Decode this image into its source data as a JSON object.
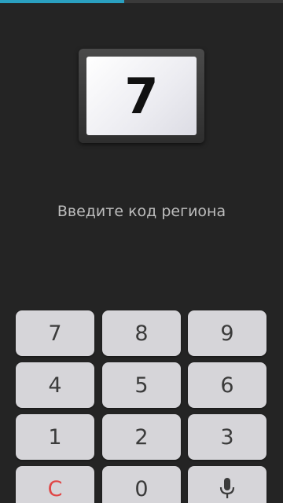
{
  "progress": {
    "fraction": 0.44
  },
  "plate": {
    "value": "7"
  },
  "prompt": {
    "text": "Введите код региона"
  },
  "keypad": {
    "keys": [
      "7",
      "8",
      "9",
      "4",
      "5",
      "6",
      "1",
      "2",
      "3",
      "C",
      "0"
    ],
    "mic_icon": "microphone-icon",
    "clear_color": "#e04646"
  }
}
